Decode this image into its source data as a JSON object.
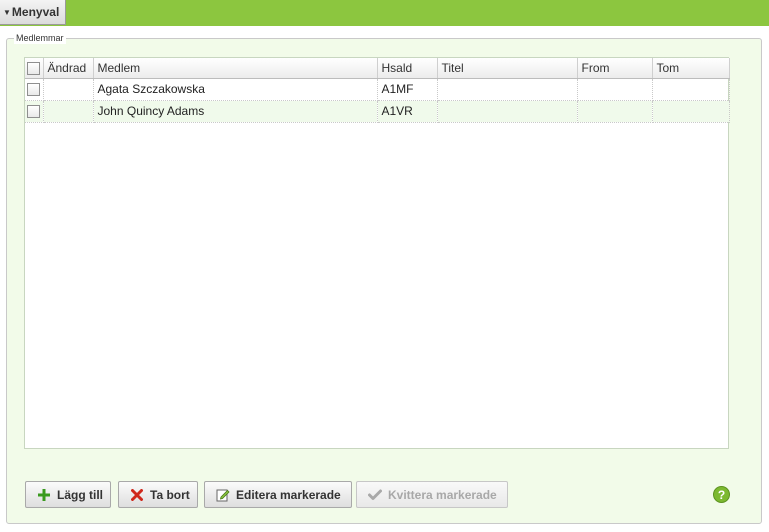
{
  "menu": {
    "label": "Menyval",
    "caret": "▼"
  },
  "fieldset": {
    "legend": "Medlemmar"
  },
  "table": {
    "columns": [
      "",
      "Ändrad",
      "Medlem",
      "Hsald",
      "Titel",
      "From",
      "Tom"
    ],
    "rows": [
      {
        "andrad": "",
        "medlem": "Agata Szczakowska",
        "hsald": "A1MF",
        "titel": "",
        "from": "",
        "tom": ""
      },
      {
        "andrad": "",
        "medlem": "John Quincy Adams",
        "hsald": "A1VR",
        "titel": "",
        "from": "",
        "tom": ""
      }
    ]
  },
  "buttons": {
    "add": "Lägg till",
    "remove": "Ta bort",
    "edit": "Editera markerade",
    "ack": "Kvittera markerade"
  },
  "help": {
    "label": "?"
  },
  "colors": {
    "topbar": "#8cc63f",
    "panel_bg": "#f2fbe9",
    "add_icon": "#3a9a1e",
    "remove_icon": "#d0281c",
    "help_bg": "#7cb930"
  },
  "icons": {
    "menu": "caret-down-icon",
    "add": "plus-icon",
    "remove": "x-icon",
    "edit": "edit-icon",
    "ack": "checkmark-icon",
    "help": "help-icon"
  }
}
